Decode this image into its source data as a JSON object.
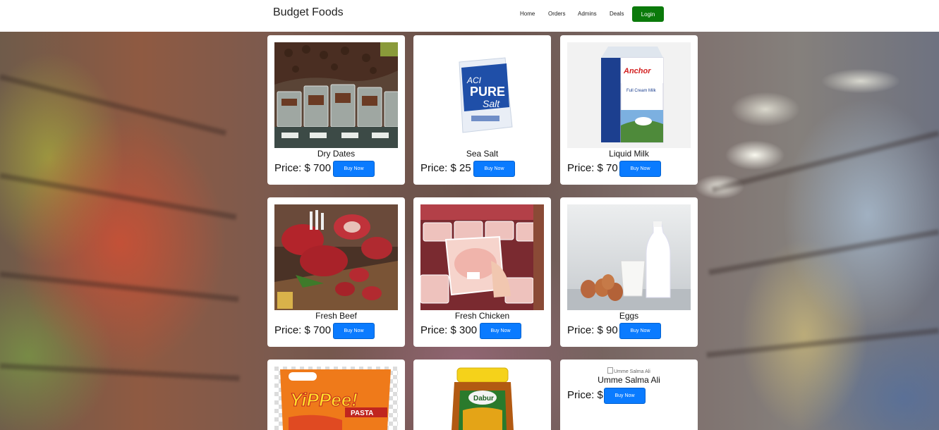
{
  "navbar": {
    "brand": "Budget Foods",
    "links": [
      "Home",
      "Orders",
      "Admins",
      "Deals"
    ],
    "login_label": "Login"
  },
  "colors": {
    "login": "#0b7a0b",
    "buy": "#0a7bff"
  },
  "buy_label": "Buy Now",
  "products": [
    {
      "name": "Dry Dates",
      "price": "Price: $ 700"
    },
    {
      "name": "Sea Salt",
      "price": "Price: $ 25"
    },
    {
      "name": "Liquid Milk",
      "price": "Price: $ 70"
    },
    {
      "name": "Fresh Beef",
      "price": "Price: $ 700"
    },
    {
      "name": "Fresh Chicken",
      "price": "Price: $ 300"
    },
    {
      "name": "Eggs",
      "price": "Price: $ 90"
    },
    {
      "name": "",
      "price": ""
    },
    {
      "name": "",
      "price": ""
    },
    {
      "name": "Umme Salma Ali",
      "price": "Price: $",
      "image_alt": "Umme Salma Ali"
    }
  ],
  "product_images": {
    "salt_brand": "ACI",
    "salt_title": "PURE",
    "salt_sub": "Salt",
    "milk_brand": "Anchor",
    "milk_label": "Full Cream Milk",
    "noodle_brand": "YiPPee!",
    "noodle_label": "PASTA",
    "honey_brand": "Dabur"
  }
}
